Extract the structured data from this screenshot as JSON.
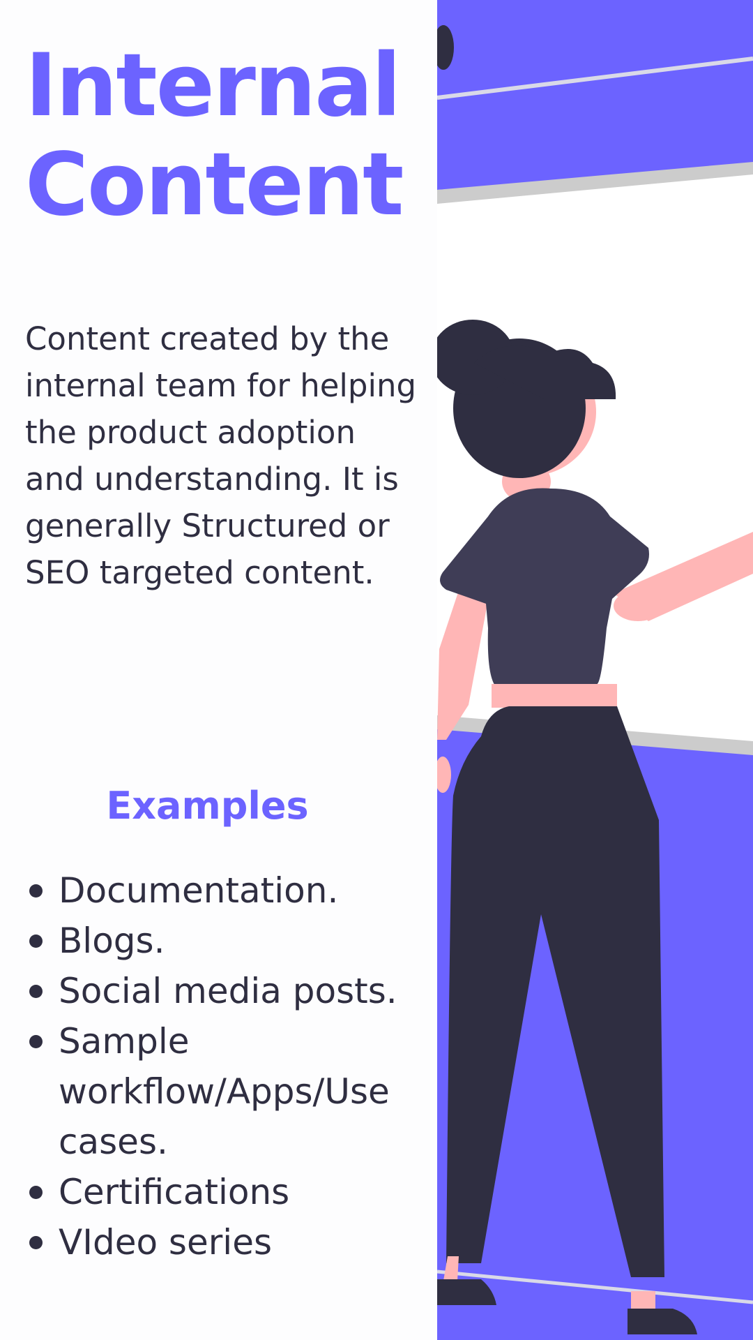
{
  "title": {
    "line1": "Internal",
    "line2": "Content"
  },
  "description": "Content created by the internal team for helping the product adoption and understanding. It is generally Structured or SEO targeted content.",
  "examples": {
    "heading": "Examples",
    "items": [
      "Documentation.",
      "Blogs.",
      "Social media posts.",
      "Sample workflow/Apps/Use cases.",
      "Certifications",
      "VIdeo series"
    ]
  },
  "colors": {
    "accent": "#6c63ff",
    "text": "#2f2e41",
    "skin": "#ffb6b6",
    "shirt": "#3f3d56",
    "rail": "#cfcfcf"
  },
  "illustration": {
    "subject": "woman-standing-at-board-illustration"
  }
}
